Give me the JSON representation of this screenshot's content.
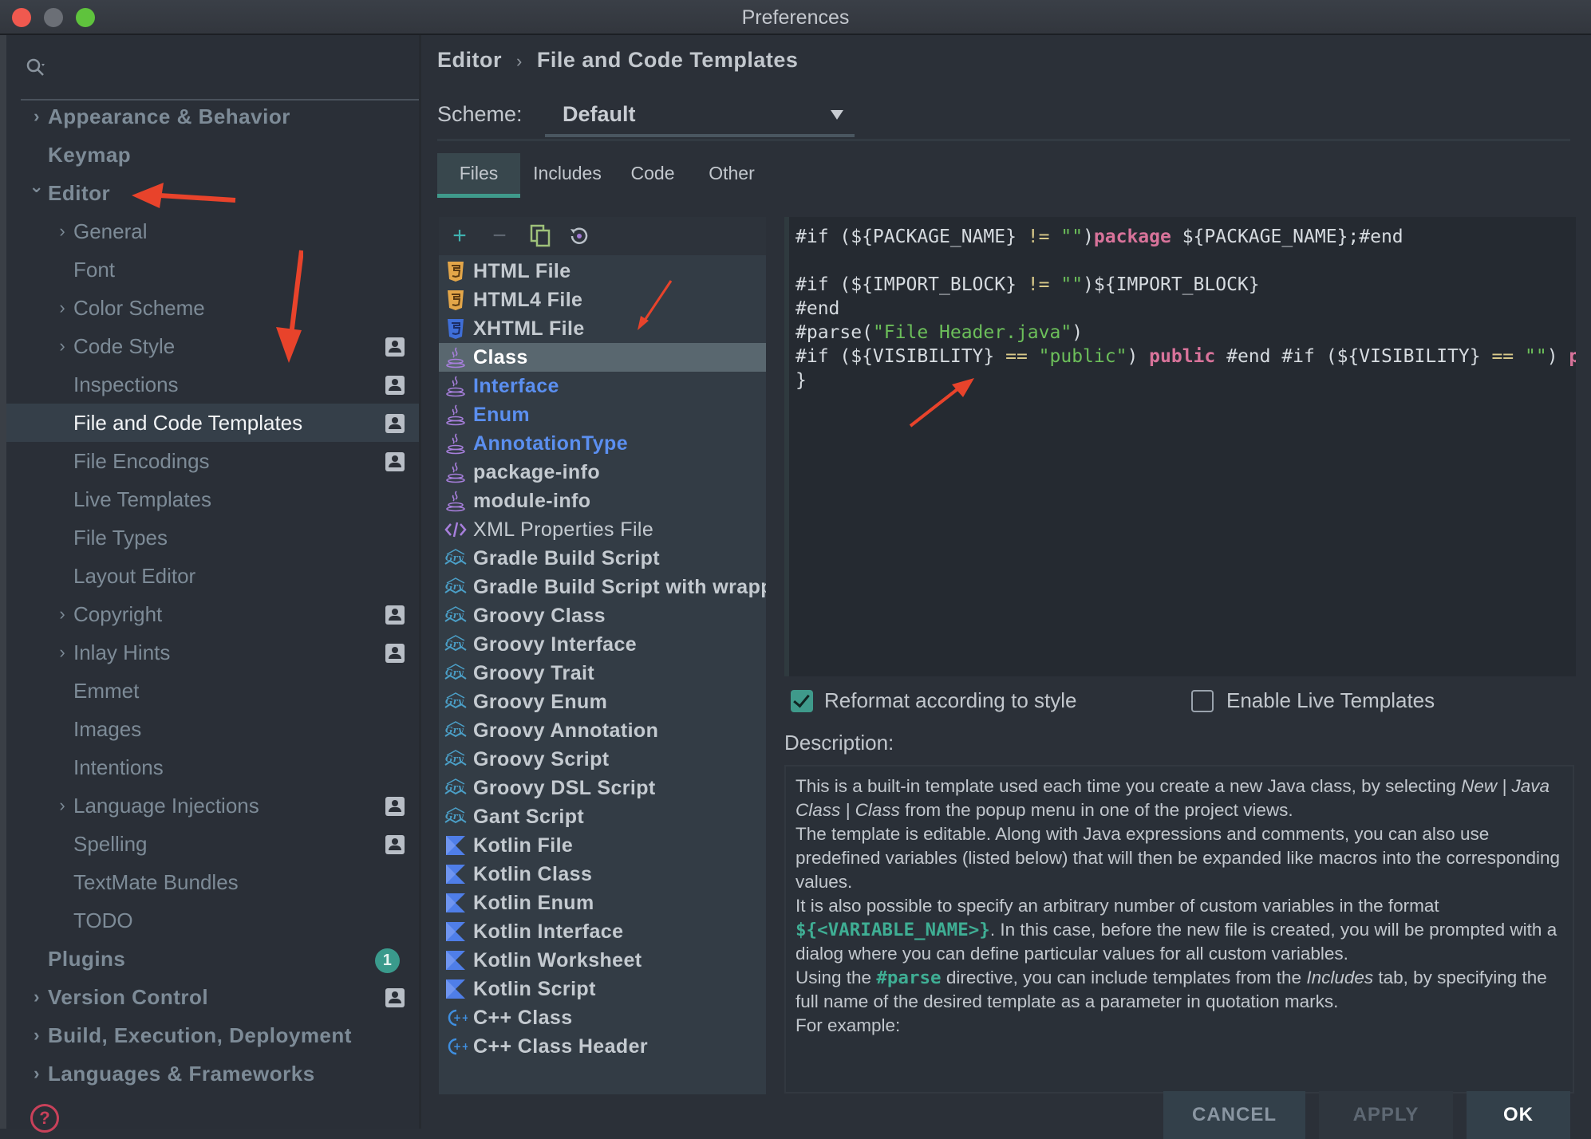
{
  "window": {
    "title": "Preferences"
  },
  "search": {
    "placeholder": ""
  },
  "sidebar": {
    "items": [
      {
        "label": "Appearance & Behavior",
        "level": 0,
        "chevron": "right",
        "project": false
      },
      {
        "label": "Keymap",
        "level": 0,
        "chevron": "",
        "project": false
      },
      {
        "label": "Editor",
        "level": 0,
        "chevron": "down",
        "project": false
      },
      {
        "label": "General",
        "level": 1,
        "chevron": "right",
        "project": false
      },
      {
        "label": "Font",
        "level": 1,
        "chevron": "",
        "project": false
      },
      {
        "label": "Color Scheme",
        "level": 1,
        "chevron": "right",
        "project": false
      },
      {
        "label": "Code Style",
        "level": 1,
        "chevron": "right",
        "project": true
      },
      {
        "label": "Inspections",
        "level": 1,
        "chevron": "",
        "project": true
      },
      {
        "label": "File and Code Templates",
        "level": 1,
        "chevron": "",
        "project": true,
        "selected": true
      },
      {
        "label": "File Encodings",
        "level": 1,
        "chevron": "",
        "project": true
      },
      {
        "label": "Live Templates",
        "level": 1,
        "chevron": "",
        "project": false
      },
      {
        "label": "File Types",
        "level": 1,
        "chevron": "",
        "project": false
      },
      {
        "label": "Layout Editor",
        "level": 1,
        "chevron": "",
        "project": false
      },
      {
        "label": "Copyright",
        "level": 1,
        "chevron": "right",
        "project": true
      },
      {
        "label": "Inlay Hints",
        "level": 1,
        "chevron": "right",
        "project": true
      },
      {
        "label": "Emmet",
        "level": 1,
        "chevron": "",
        "project": false
      },
      {
        "label": "Images",
        "level": 1,
        "chevron": "",
        "project": false
      },
      {
        "label": "Intentions",
        "level": 1,
        "chevron": "",
        "project": false
      },
      {
        "label": "Language Injections",
        "level": 1,
        "chevron": "right",
        "project": true
      },
      {
        "label": "Spelling",
        "level": 1,
        "chevron": "",
        "project": true
      },
      {
        "label": "TextMate Bundles",
        "level": 1,
        "chevron": "",
        "project": false
      },
      {
        "label": "TODO",
        "level": 1,
        "chevron": "",
        "project": false
      },
      {
        "label": "Plugins",
        "level": 0,
        "chevron": "",
        "project": false,
        "badge": "1"
      },
      {
        "label": "Version Control",
        "level": 0,
        "chevron": "right",
        "project": true
      },
      {
        "label": "Build, Execution, Deployment",
        "level": 0,
        "chevron": "right",
        "project": false
      },
      {
        "label": "Languages & Frameworks",
        "level": 0,
        "chevron": "right",
        "project": false
      }
    ],
    "help_icon": "question-circle-icon"
  },
  "breadcrumb": {
    "parent": "Editor",
    "separator": "›",
    "current": "File and Code Templates"
  },
  "scheme": {
    "label": "Scheme:",
    "value": "Default"
  },
  "tabs": [
    {
      "label": "Files",
      "active": true
    },
    {
      "label": "Includes",
      "active": false
    },
    {
      "label": "Code",
      "active": false
    },
    {
      "label": "Other",
      "active": false
    }
  ],
  "toolbar": {
    "add": "+",
    "remove": "−",
    "copy_icon": "copy-icon",
    "reset_icon": "reset-icon"
  },
  "templates": [
    {
      "label": "HTML File",
      "icon": "html5",
      "style": "bold"
    },
    {
      "label": "HTML4 File",
      "icon": "html5",
      "style": "bold"
    },
    {
      "label": "XHTML File",
      "icon": "css3",
      "style": "bold"
    },
    {
      "label": "Class",
      "icon": "java",
      "style": "bold",
      "selected": true
    },
    {
      "label": "Interface",
      "icon": "java",
      "style": "blue"
    },
    {
      "label": "Enum",
      "icon": "java",
      "style": "blue"
    },
    {
      "label": "AnnotationType",
      "icon": "java",
      "style": "blue"
    },
    {
      "label": "package-info",
      "icon": "java",
      "style": "bold"
    },
    {
      "label": "module-info",
      "icon": "java",
      "style": "bold"
    },
    {
      "label": "XML Properties File",
      "icon": "xml",
      "style": "plain"
    },
    {
      "label": "Gradle Build Script",
      "icon": "groovy",
      "style": "bold"
    },
    {
      "label": "Gradle Build Script with wrapper",
      "icon": "groovy",
      "style": "bold"
    },
    {
      "label": "Groovy Class",
      "icon": "groovy",
      "style": "bold"
    },
    {
      "label": "Groovy Interface",
      "icon": "groovy",
      "style": "bold"
    },
    {
      "label": "Groovy Trait",
      "icon": "groovy",
      "style": "bold"
    },
    {
      "label": "Groovy Enum",
      "icon": "groovy",
      "style": "bold"
    },
    {
      "label": "Groovy Annotation",
      "icon": "groovy",
      "style": "bold"
    },
    {
      "label": "Groovy Script",
      "icon": "groovy",
      "style": "bold"
    },
    {
      "label": "Groovy DSL Script",
      "icon": "groovy",
      "style": "bold"
    },
    {
      "label": "Gant Script",
      "icon": "groovy",
      "style": "bold"
    },
    {
      "label": "Kotlin File",
      "icon": "kotlin",
      "style": "bold"
    },
    {
      "label": "Kotlin Class",
      "icon": "kotlin",
      "style": "bold"
    },
    {
      "label": "Kotlin Enum",
      "icon": "kotlin",
      "style": "bold"
    },
    {
      "label": "Kotlin Interface",
      "icon": "kotlin",
      "style": "bold"
    },
    {
      "label": "Kotlin Worksheet",
      "icon": "kotlin",
      "style": "bold"
    },
    {
      "label": "Kotlin Script",
      "icon": "kotlin",
      "style": "bold"
    },
    {
      "label": "C++ Class",
      "icon": "cpp",
      "style": "bold"
    },
    {
      "label": "C++ Class Header",
      "icon": "cpp",
      "style": "bold"
    }
  ],
  "editor": {
    "lines": [
      [
        {
          "t": "#if (${PACKAGE_NAME} "
        },
        {
          "t": "!=",
          "c": "op"
        },
        {
          "t": " "
        },
        {
          "t": "\"\"",
          "c": "str"
        },
        {
          "t": ")"
        },
        {
          "t": "package",
          "c": "kw"
        },
        {
          "t": " ${PACKAGE_NAME};#end"
        }
      ],
      [],
      [
        {
          "t": "#if (${IMPORT_BLOCK} "
        },
        {
          "t": "!=",
          "c": "op"
        },
        {
          "t": " "
        },
        {
          "t": "\"\"",
          "c": "str"
        },
        {
          "t": ")${IMPORT_BLOCK}"
        }
      ],
      [
        {
          "t": "#end"
        }
      ],
      [
        {
          "t": "#parse("
        },
        {
          "t": "\"File Header.java\"",
          "c": "str"
        },
        {
          "t": ")"
        }
      ],
      [
        {
          "t": "#if (${VISIBILITY} "
        },
        {
          "t": "==",
          "c": "op"
        },
        {
          "t": " "
        },
        {
          "t": "\"public\"",
          "c": "str"
        },
        {
          "t": ") "
        },
        {
          "t": "public",
          "c": "kw"
        },
        {
          "t": " #end #if (${VISIBILITY} "
        },
        {
          "t": "==",
          "c": "op"
        },
        {
          "t": " "
        },
        {
          "t": "\"\"",
          "c": "str"
        },
        {
          "t": ") "
        },
        {
          "t": "p",
          "c": "kw"
        }
      ],
      [
        {
          "t": "}"
        }
      ]
    ]
  },
  "options": {
    "reformat": {
      "label": "Reformat according to style",
      "checked": true
    },
    "live_templates": {
      "label": "Enable Live Templates",
      "checked": false
    }
  },
  "description": {
    "label": "Description:",
    "paragraphs": [
      [
        {
          "t": "This is a built-in template used each time you create a new Java class, by selecting "
        },
        {
          "t": "New | Java Class | Class",
          "i": true
        },
        {
          "t": " from the popup menu in one of the project views."
        }
      ],
      [
        {
          "t": "The template is editable. Along with Java expressions and comments, you can also use predefined variables (listed below) that will then be expanded like macros into the corresponding values."
        }
      ],
      [
        {
          "t": "It is also possible to specify an arbitrary number of custom variables in the format "
        },
        {
          "t": "${<VARIABLE_NAME>}",
          "v": true
        },
        {
          "t": ". In this case, before the new file is created, you will be prompted with a dialog where you can define particular values for all custom variables."
        }
      ],
      [
        {
          "t": "Using the "
        },
        {
          "t": "#parse",
          "v": true
        },
        {
          "t": " directive, you can include templates from the "
        },
        {
          "t": "Includes",
          "i": true
        },
        {
          "t": " tab, by specifying the full name of the desired template as a parameter in quotation marks."
        }
      ],
      [
        {
          "t": "For example:"
        }
      ]
    ]
  },
  "buttons": {
    "cancel": "CANCEL",
    "apply": "APPLY",
    "ok": "OK"
  },
  "colors": {
    "accent": "#3f9a8b",
    "selection": "#353f49",
    "keyword": "#d8739a",
    "string": "#6cbf5a",
    "annotation_arrow": "#e8432b"
  }
}
